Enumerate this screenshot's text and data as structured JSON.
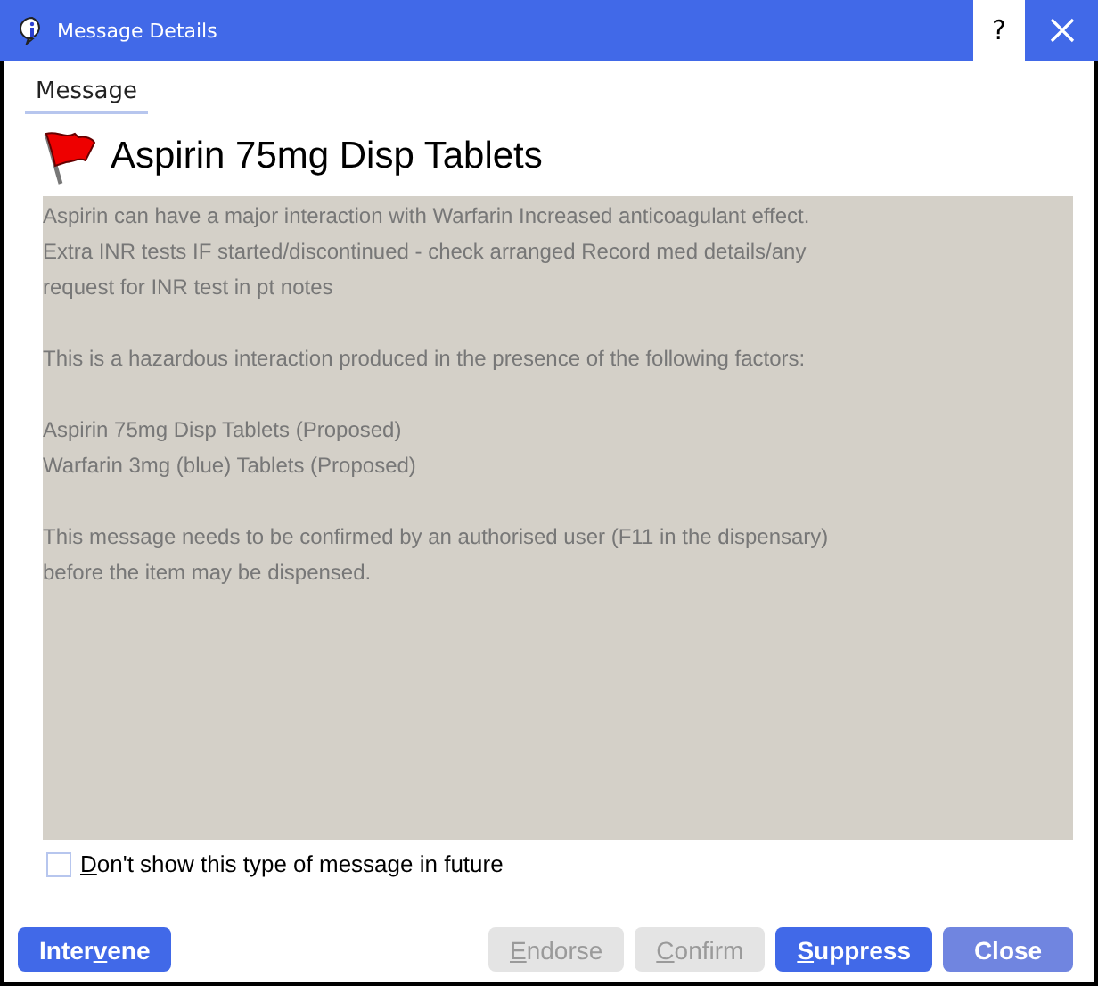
{
  "window": {
    "title": "Message Details",
    "help": "?"
  },
  "tabs": [
    {
      "label": "Message",
      "selected": true
    }
  ],
  "heading": "Aspirin 75mg Disp Tablets",
  "message": [
    [
      "Aspirin can have a major interaction with Warfarin Increased anticoagulant effect.",
      "Extra INR tests IF started/discontinued - check arranged Record med details/any",
      "request for INR test in pt notes"
    ],
    [
      "This is a hazardous interaction produced in the presence of the following factors:"
    ],
    [
      "Aspirin 75mg Disp Tablets (Proposed)",
      "Warfarin 3mg (blue) Tablets (Proposed)"
    ],
    [
      "This message needs to be confirmed by an authorised user (F11 in the dispensary)",
      "before the item may be dispensed."
    ]
  ],
  "dont_show": {
    "label": {
      "key": "D",
      "post": "on't show this type of message in future"
    },
    "checked": false
  },
  "left_buttons": [
    {
      "label": {
        "pre": "Inter",
        "key": "v",
        "post": "ene"
      },
      "disabled": false,
      "kind": "primary"
    }
  ],
  "right_buttons": [
    {
      "label": {
        "key": "E",
        "post": "ndorse"
      },
      "disabled": true
    },
    {
      "label": {
        "key": "C",
        "post": "onfirm"
      },
      "disabled": true
    },
    {
      "label": {
        "key": "S",
        "post": "uppress"
      },
      "disabled": false,
      "kind": "primary"
    },
    {
      "label": {
        "pre": "Close"
      },
      "disabled": false,
      "kind": "light"
    }
  ]
}
